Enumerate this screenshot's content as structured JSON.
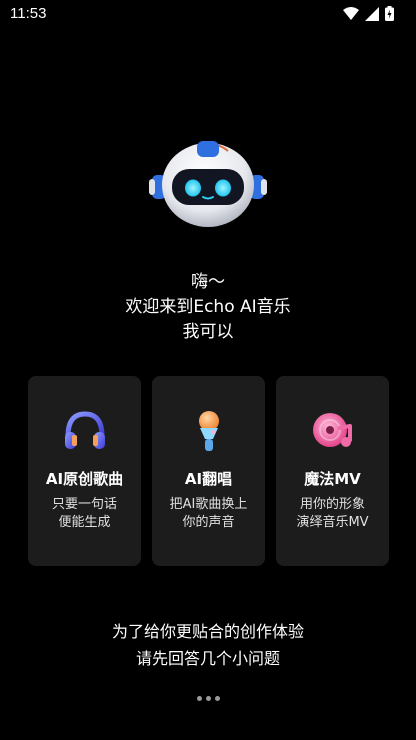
{
  "status_bar": {
    "time": "11:53",
    "icons": [
      "wifi-icon",
      "cellular-signal-icon",
      "battery-charging-icon"
    ]
  },
  "greeting": {
    "line1": "嗨～",
    "line2": "欢迎来到Echo AI音乐",
    "line3": "我可以"
  },
  "features": [
    {
      "icon": "headphones-icon",
      "title": "AI原创歌曲",
      "desc_line1": "只要一句话",
      "desc_line2": "便能生成"
    },
    {
      "icon": "microphone-icon",
      "title": "AI翻唱",
      "desc_line1": "把AI歌曲换上",
      "desc_line2": "你的声音"
    },
    {
      "icon": "music-disc-icon",
      "title": "魔法MV",
      "desc_line1": "用你的形象",
      "desc_line2": "演绎音乐MV"
    }
  ],
  "footer": {
    "line1": "为了给你更贴合的创作体验",
    "line2": "请先回答几个小问题"
  },
  "colors": {
    "background": "#000000",
    "card": "#1c1c1c",
    "robot_accent": "#2f6fe0"
  }
}
